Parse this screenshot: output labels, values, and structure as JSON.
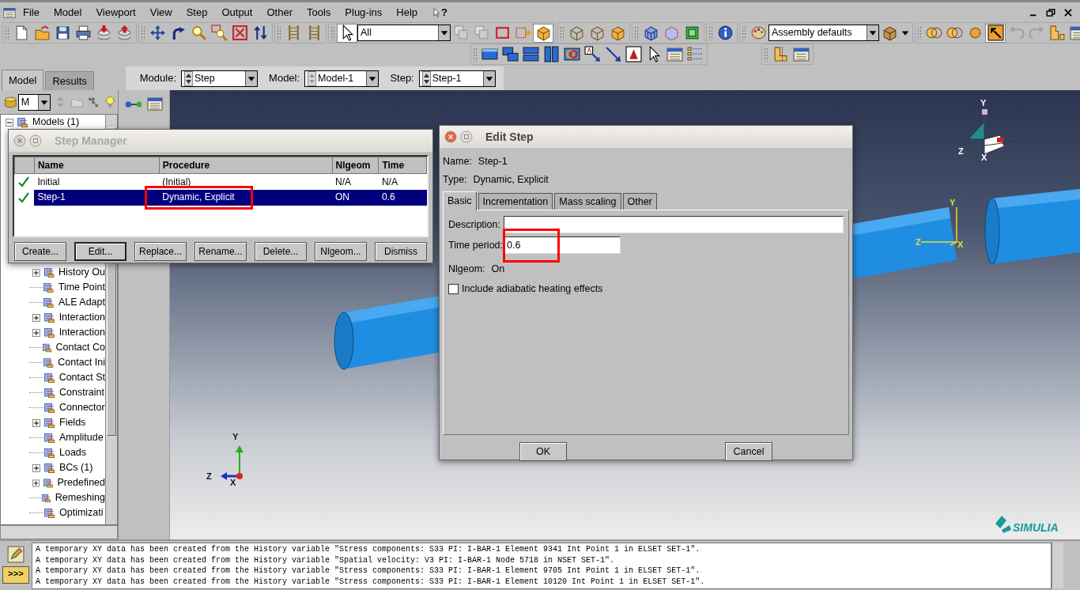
{
  "menu_bar": {
    "items": [
      "File",
      "Model",
      "Viewport",
      "View",
      "Step",
      "Output",
      "Other",
      "Tools",
      "Plug-ins",
      "Help"
    ],
    "help_item": "?"
  },
  "toolbar": {
    "selection_filter": "All",
    "render_style": "Assembly defaults"
  },
  "tree_tabs": [
    {
      "label": "Model",
      "selected": true
    },
    {
      "label": "Results",
      "selected": false
    }
  ],
  "context_bar": [
    {
      "label": "Module:",
      "value": "Step"
    },
    {
      "label": "Model:",
      "value": "Model-1"
    },
    {
      "label": "Step:",
      "value": "Step-1"
    }
  ],
  "model_tree": {
    "filter_value": "M",
    "root": {
      "label": "Models (1)",
      "expanded": true
    },
    "items": [
      {
        "label": "History Ou",
        "expandable": true
      },
      {
        "label": "Time Point",
        "expandable": false
      },
      {
        "label": "ALE Adapt",
        "expandable": false
      },
      {
        "label": "Interaction",
        "expandable": true
      },
      {
        "label": "Interaction",
        "expandable": true
      },
      {
        "label": "Contact Co",
        "expandable": false
      },
      {
        "label": "Contact Ini",
        "expandable": false
      },
      {
        "label": "Contact St",
        "expandable": false
      },
      {
        "label": "Constraint",
        "expandable": false
      },
      {
        "label": "Connector",
        "expandable": false
      },
      {
        "label": "Fields",
        "expandable": true
      },
      {
        "label": "Amplitude",
        "expandable": false
      },
      {
        "label": "Loads",
        "expandable": false
      },
      {
        "label": "BCs (1)",
        "expandable": true
      },
      {
        "label": "Predefined",
        "expandable": true
      },
      {
        "label": "Remeshing",
        "expandable": false
      },
      {
        "label": "Optimizati",
        "expandable": false
      }
    ]
  },
  "step_manager": {
    "title": "Step Manager",
    "active": false,
    "columns": [
      "Name",
      "Procedure",
      "Nlgeom",
      "Time"
    ],
    "rows": [
      {
        "valid": true,
        "name": "Initial",
        "procedure": "(Initial)",
        "nlgeom": "N/A",
        "time": "N/A",
        "selected": false,
        "highlighted": false
      },
      {
        "valid": true,
        "name": "Step-1",
        "procedure": "Dynamic, Explicit",
        "nlgeom": "ON",
        "time": "0.6",
        "selected": true,
        "highlighted": true
      }
    ],
    "buttons": [
      {
        "label": "Create...",
        "default": false
      },
      {
        "label": "Edit...",
        "default": true
      },
      {
        "label": "Replace...",
        "default": false
      },
      {
        "label": "Rename...",
        "default": false
      },
      {
        "label": "Delete...",
        "default": false
      },
      {
        "label": "Nlgeom...",
        "default": false
      },
      {
        "label": "Dismiss",
        "default": false
      }
    ]
  },
  "edit_step": {
    "title": "Edit Step",
    "active": true,
    "name_label": "Name:",
    "name": "Step-1",
    "type_label": "Type:",
    "type": "Dynamic, Explicit",
    "tabs": [
      {
        "label": "Basic",
        "selected": true
      },
      {
        "label": "Incrementation",
        "selected": false
      },
      {
        "label": "Mass scaling",
        "selected": false
      },
      {
        "label": "Other",
        "selected": false
      }
    ],
    "fields": [
      {
        "label": "Description:",
        "wide": true,
        "highlighted": false
      },
      {
        "label": "Time period:",
        "value": "0.6",
        "wide": false,
        "highlighted": true
      }
    ],
    "nlgeom_label": "Nlgeom:",
    "nlgeom": "On",
    "checkbox": {
      "label": "Include adiabatic heating effects",
      "checked": false
    },
    "buttons": [
      "OK",
      "Cancel"
    ]
  },
  "viewport": {
    "view_triad": [
      "Y",
      "Z",
      "X"
    ],
    "part_triad": [
      "Y",
      "Z",
      "X"
    ],
    "global_triad": [
      "Y",
      "Z",
      "X"
    ],
    "logo": "SIMULIA"
  },
  "message_area": {
    "command_button": ">>>",
    "messages": [
      "A temporary XY data has been created from the History variable \"Stress components: S33 PI: I-BAR-1 Element 9341 Int Point 1 in ELSET SET-1\".",
      "A temporary XY data has been created from the History variable \"Spatial velocity: V3 PI: I-BAR-1 Node 5718 in NSET SET-1\".",
      "A temporary XY data has been created from the History variable \"Stress components: S33 PI: I-BAR-1 Element 9705 Int Point 1 in ELSET SET-1\".",
      "A temporary XY data has been created from the History variable \"Stress components: S33 PI: I-BAR-1 Element 10120 Int Point 1 in ELSET SET-1\"."
    ]
  }
}
